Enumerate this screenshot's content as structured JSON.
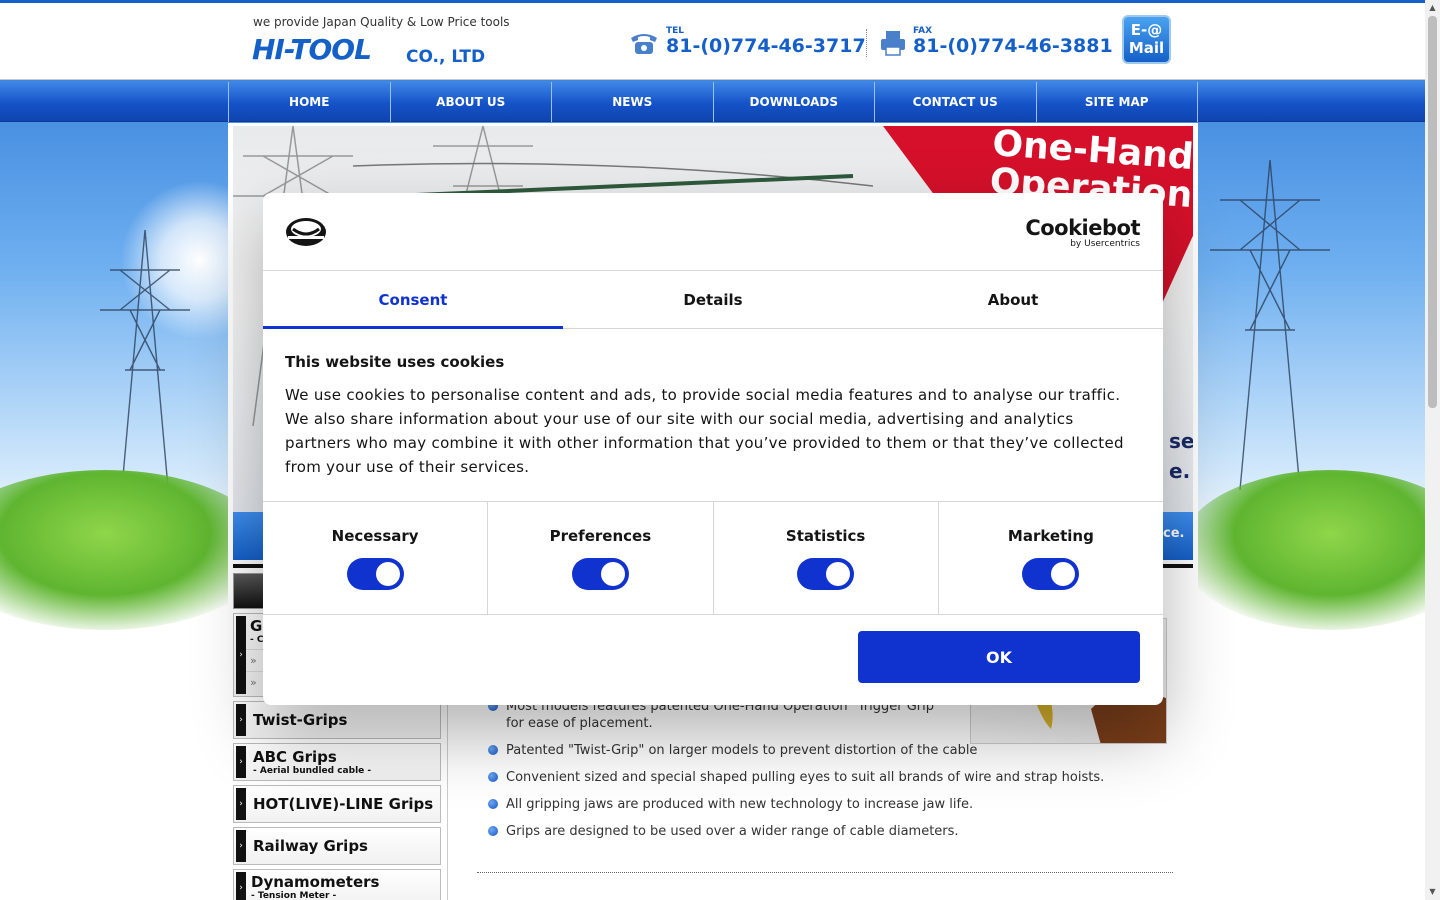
{
  "header": {
    "tagline": "we provide Japan Quality & Low Price tools",
    "logo": "HI-TOOL",
    "logo_sub": "CO., LTD",
    "tel_label": "TEL",
    "tel_number": "81-(0)774-46-3717",
    "fax_label": "FAX",
    "fax_number": "81-(0)774-46-3881",
    "email_line1": "E-@",
    "email_line2": "Mail"
  },
  "nav": {
    "items": [
      "HOME",
      "ABOUT US",
      "NEWS",
      "DOWNLOADS",
      "CONTACT US",
      "SITE MAP"
    ]
  },
  "hero": {
    "title_line1": "One-Hand",
    "title_line2": "Operation",
    "side_line1": "se",
    "side_line2": "e.",
    "strip_text": "ce."
  },
  "sidebar": {
    "group_label": "G",
    "group_sub": "- C",
    "sublinks": [
      "»",
      "»"
    ],
    "items": [
      {
        "label": "Twist-Grips",
        "sub": ""
      },
      {
        "label": "ABC Grips",
        "sub": "- Aerial bundled cable -"
      },
      {
        "label": "HOT(LIVE)-LINE Grips",
        "sub": ""
      },
      {
        "label": "Railway Grips",
        "sub": ""
      },
      {
        "label": "Dynamometers",
        "sub": "- Tension Meter -"
      }
    ]
  },
  "features": [
    "Most models features patented One-Hand Operation \"Trigger Grip\" for ease of placement.",
    "Patented \"Twist-Grip\" on larger models to prevent distortion of the cable",
    "Convenient sized and special shaped pulling eyes to suit all brands of wire and strap hoists.",
    "All gripping jaws are produced with new technology to increase jaw life.",
    "Grips are designed to be used over a wider range of cable diameters."
  ],
  "cookie": {
    "brand": "Cookiebot",
    "brand_by": "by Usercentrics",
    "tabs": [
      "Consent",
      "Details",
      "About"
    ],
    "active_tab": "Consent",
    "title": "This website uses cookies",
    "text": "We use cookies to personalise content and ads, to provide social media features and to analyse our traffic. We also share information about your use of our site with our social media, advertising and analytics partners who may combine it with other information that you’ve provided to them or that they’ve collected from your use of their services.",
    "toggles": [
      {
        "label": "Necessary",
        "on": true
      },
      {
        "label": "Preferences",
        "on": true
      },
      {
        "label": "Statistics",
        "on": true
      },
      {
        "label": "Marketing",
        "on": true
      }
    ],
    "ok_label": "OK",
    "accent": "#1032cf"
  },
  "colors": {
    "brand_blue": "#1560c8",
    "hero_red": "#d6102a"
  }
}
